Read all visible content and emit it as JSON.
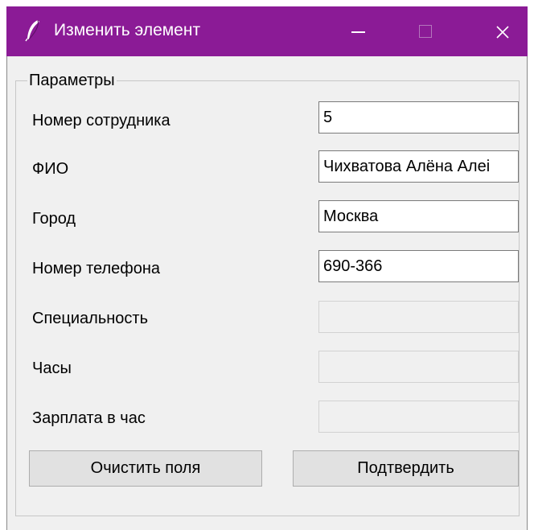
{
  "window": {
    "title": "Изменить элемент",
    "icon": "feather-icon",
    "controls": [
      "minimize-icon",
      "maximize-icon",
      "close-icon"
    ],
    "accent_color": "#8b1b96"
  },
  "group": {
    "legend": "Параметры"
  },
  "fields": [
    {
      "label": "Номер сотрудника",
      "value": "5",
      "enabled": true
    },
    {
      "label": "ФИО",
      "value": "Чихватова Алёна Алеі",
      "enabled": true
    },
    {
      "label": "Город",
      "value": "Москва",
      "enabled": true
    },
    {
      "label": "Номер телефона",
      "value": "690-366",
      "enabled": true
    },
    {
      "label": "Специальность",
      "value": "",
      "enabled": false
    },
    {
      "label": "Часы",
      "value": "",
      "enabled": false
    },
    {
      "label": "Зарплата в час",
      "value": "",
      "enabled": false
    }
  ],
  "buttons": {
    "clear": "Очистить поля",
    "confirm": "Подтвердить"
  }
}
